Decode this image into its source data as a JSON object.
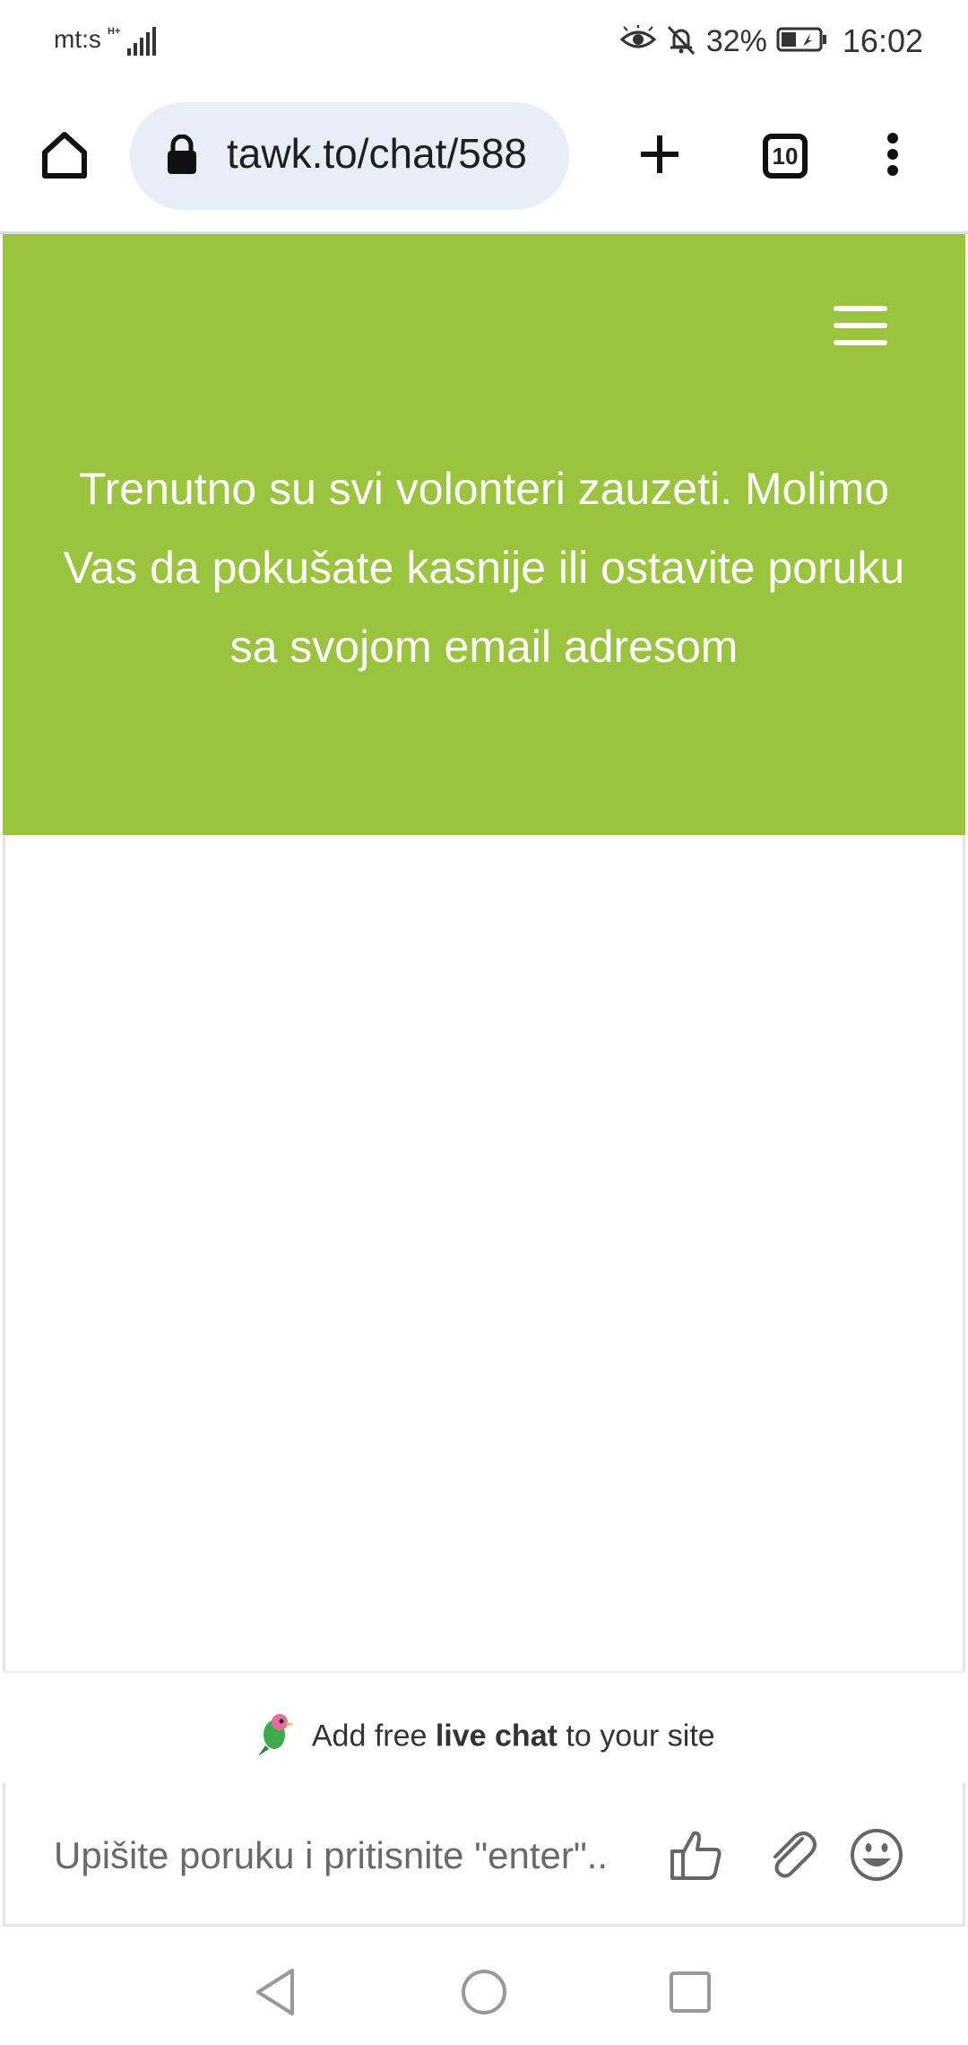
{
  "status_bar": {
    "carrier": "mt:s",
    "network_type": "H+",
    "battery_percent": "32%",
    "time": "16:02"
  },
  "browser": {
    "url": "tawk.to/chat/588",
    "tab_count": "10"
  },
  "chat": {
    "header_message": "Trenutno su svi volonteri zauzeti. Molimo Vas da pokušate kasnije ili ostavite poruku sa svojom email adresom",
    "promo": {
      "prefix": "Add free",
      "bold": "live chat",
      "suffix": "to your site"
    },
    "input_placeholder": "Upišite poruku i pritisnite \"enter\".."
  },
  "colors": {
    "header_bg": "#9ac43d",
    "urlbar_bg": "#e8eef7"
  }
}
